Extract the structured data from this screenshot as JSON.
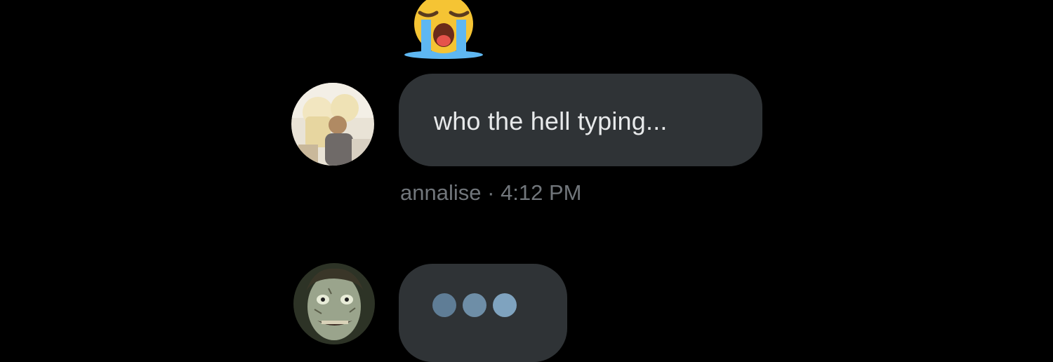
{
  "reaction": {
    "emoji": "loudly-crying-face",
    "color": "#f5c434"
  },
  "messages": [
    {
      "avatar": "photo-avatar",
      "text": "who the hell typing...",
      "sender": "annalise",
      "separator": "·",
      "time": "4:12 PM"
    },
    {
      "avatar": "creepy-face-avatar",
      "typing_indicator": true
    }
  ],
  "colors": {
    "background": "#000000",
    "bubble": "#2f3336",
    "text": "#e7e9ea",
    "meta": "#71767b",
    "typing_dot": "#7fa3bf"
  }
}
